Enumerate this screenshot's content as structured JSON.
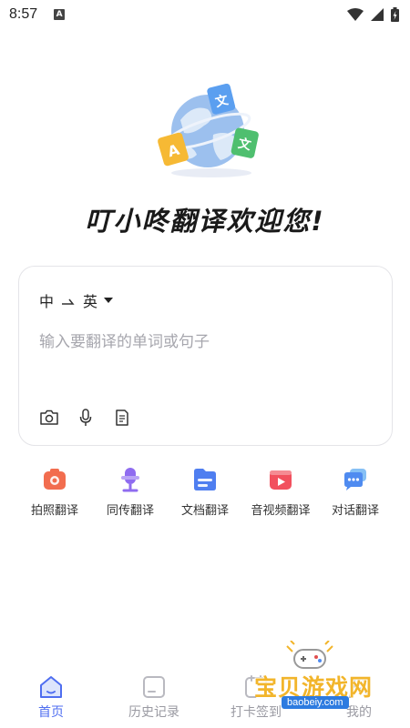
{
  "status_bar": {
    "time": "8:57",
    "notification_letter": "A"
  },
  "hero": {
    "title": "叮小咚翻译欢迎您!"
  },
  "translate_card": {
    "source_lang": "中",
    "target_lang": "英",
    "placeholder": "输入要翻译的单词或句子",
    "tools": [
      "camera-icon",
      "microphone-icon",
      "document-icon"
    ]
  },
  "features": [
    {
      "label": "拍照翻译",
      "icon": "camera-translate-icon",
      "color": "#f26d4f"
    },
    {
      "label": "同传翻译",
      "icon": "mic-translate-icon",
      "color": "#8f6cf0"
    },
    {
      "label": "文档翻译",
      "icon": "doc-translate-icon",
      "color": "#4f7ef0"
    },
    {
      "label": "音视频翻译",
      "icon": "video-translate-icon",
      "color": "#f2505e"
    },
    {
      "label": "对话翻译",
      "icon": "chat-translate-icon",
      "color": "#4f8bf0"
    }
  ],
  "bottom_nav": [
    {
      "label": "首页",
      "icon": "home-icon",
      "active": true
    },
    {
      "label": "历史记录",
      "icon": "history-icon",
      "active": false
    },
    {
      "label": "打卡签到",
      "icon": "checkin-icon",
      "active": false
    },
    {
      "label": "我的",
      "icon": "profile-icon",
      "active": false
    }
  ],
  "watermark": {
    "text": "宝贝游戏网",
    "url": "baobeiy.com"
  },
  "colors": {
    "accent": "#4f6ef0",
    "inactive": "#9a9aa2",
    "placeholder": "#a6a6ad"
  }
}
